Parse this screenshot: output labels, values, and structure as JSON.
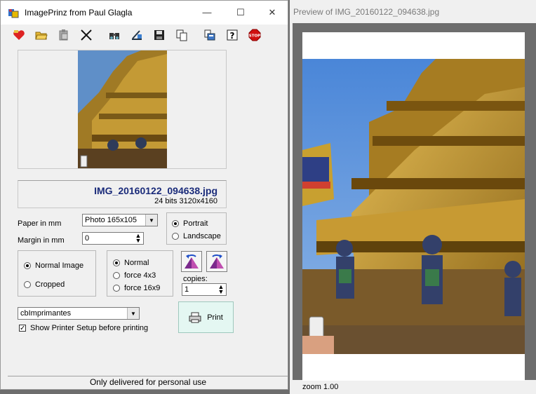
{
  "app": {
    "title": "ImagePrinz from  Paul Glagla",
    "window_buttons": {
      "minimize": "—",
      "maximize": "☐",
      "close": "✕"
    }
  },
  "toolbar": {
    "items": [
      {
        "name": "favorites-icon"
      },
      {
        "name": "open-folder-icon"
      },
      {
        "name": "paste-icon"
      },
      {
        "name": "crop-tool-icon"
      },
      {
        "name": "binoculars-icon"
      },
      {
        "name": "edit-image-icon"
      },
      {
        "name": "save-disk-icon"
      },
      {
        "name": "copy-icon"
      },
      {
        "name": "printer-settings-icon"
      },
      {
        "name": "help-icon"
      },
      {
        "name": "stop-icon",
        "label": "STOP"
      }
    ]
  },
  "file": {
    "name": "IMG_20160122_094638.jpg",
    "info": "24 bits 3120x4160"
  },
  "paper": {
    "label": "Paper in mm",
    "value": "Photo 165x105",
    "margin_label": "Margin in mm",
    "margin_value": "0"
  },
  "orientation": {
    "portrait": "Portrait",
    "landscape": "Landscape",
    "selected": "Portrait"
  },
  "image_mode": {
    "normal": "Normal Image",
    "cropped": "Cropped",
    "selected": "Normal Image"
  },
  "aspect": {
    "normal": "Normal",
    "force4x3": "force 4x3",
    "force16x9": "force 16x9",
    "selected": "Normal"
  },
  "copies": {
    "label": "copies:",
    "value": "1"
  },
  "printer": {
    "value": "cbImprimantes",
    "setup_label": "Show Printer Setup before printing",
    "setup_checked": true
  },
  "print_button": "Print",
  "status": "Only delivered for personal use",
  "preview": {
    "title": "Preview of IMG_20160122_094638.jpg",
    "zoom": "zoom 1.00"
  },
  "colors": {
    "filename": "#1a2b7a",
    "print_button_bg": "#e4f7f2",
    "stop_red": "#d01010"
  }
}
